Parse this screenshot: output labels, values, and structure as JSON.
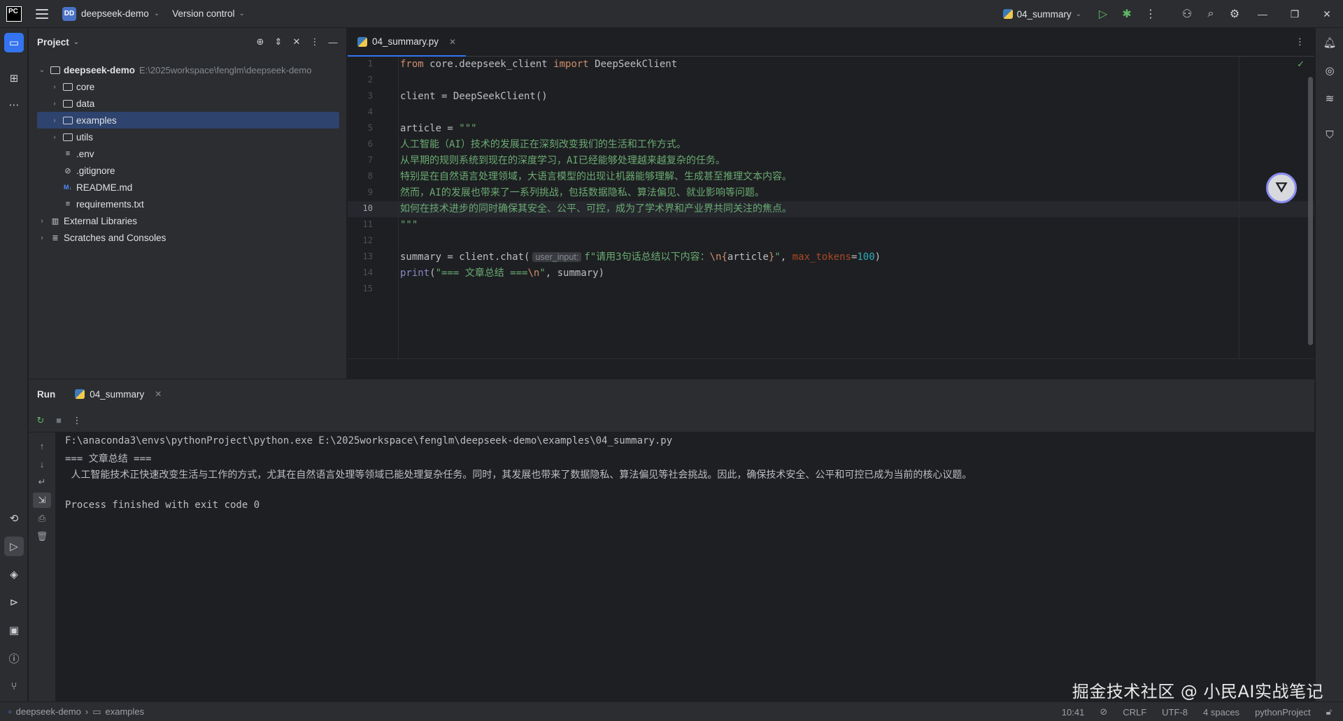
{
  "titlebar": {
    "project_badge": "DD",
    "project_name": "deepseek-demo",
    "vcs": "Version control",
    "run_config": "04_summary"
  },
  "project_panel": {
    "title": "Project",
    "root": {
      "name": "deepseek-demo",
      "path": "E:\\2025workspace\\fenglm\\deepseek-demo"
    },
    "items": [
      {
        "name": "core",
        "type": "folder"
      },
      {
        "name": "data",
        "type": "folder"
      },
      {
        "name": "examples",
        "type": "folder",
        "selected": true
      },
      {
        "name": "utils",
        "type": "folder"
      },
      {
        "name": ".env",
        "type": "file"
      },
      {
        "name": ".gitignore",
        "type": "ignore-file"
      },
      {
        "name": "README.md",
        "type": "markdown"
      },
      {
        "name": "requirements.txt",
        "type": "file"
      }
    ],
    "external_libraries": "External Libraries",
    "scratches": "Scratches and Consoles"
  },
  "editor": {
    "tab": "04_summary.py",
    "current_line": 10,
    "lines": {
      "l1": {
        "kw1": "from",
        "mod": " core.deepseek_client ",
        "kw2": "import",
        "cls": " DeepSeekClient"
      },
      "l3": "client = DeepSeekClient()",
      "l5": {
        "pre": "article = ",
        "str": "\"\"\""
      },
      "l6": "人工智能（AI）技术的发展正在深刻改变我们的生活和工作方式。",
      "l7": "从早期的规则系统到现在的深度学习，AI已经能够处理越来越复杂的任务。",
      "l8": "特别是在自然语言处理领域，大语言模型的出现让机器能够理解、生成甚至推理文本内容。",
      "l9": "然而，AI的发展也带来了一系列挑战，包括数据隐私、算法偏见、就业影响等问题。",
      "l10": "如何在技术进步的同时确保其安全、公平、可控，成为了学术界和产业界共同关注的焦点。",
      "l11": "\"\"\"",
      "l13": {
        "pre": "summary = client.chat(",
        "inlay": "user_input:",
        "str1": "f\"请用3句话总结以下内容：",
        "esc": "\\n",
        "brace_open": "{",
        "var": "article",
        "brace_close": "}",
        "str2": "\"",
        "comma": ", ",
        "param": "max_tokens",
        "eq": "=",
        "num": "100",
        "close": ")"
      },
      "l14": {
        "fn": "print",
        "open": "(",
        "str1": "\"=== 文章总结 ===",
        "esc": "\\n",
        "str2": "\"",
        "rest": ", summary)"
      }
    },
    "line_numbers": [
      "1",
      "2",
      "3",
      "4",
      "5",
      "6",
      "7",
      "8",
      "9",
      "10",
      "11",
      "12",
      "13",
      "14",
      "15"
    ]
  },
  "run_panel": {
    "title": "Run",
    "tab": "04_summary",
    "output": [
      "F:\\anaconda3\\envs\\pythonProject\\python.exe E:\\2025workspace\\fenglm\\deepseek-demo\\examples\\04_summary.py",
      "=== 文章总结 ===",
      " 人工智能技术正快速改变生活与工作的方式，尤其在自然语言处理等领域已能处理复杂任务。同时，其发展也带来了数据隐私、算法偏见等社会挑战。因此，确保技术安全、公平和可控已成为当前的核心议题。",
      "",
      "Process finished with exit code 0"
    ]
  },
  "watermark": "掘金技术社区 @ 小民AI实战笔记",
  "statusbar": {
    "breadcrumb_project": "deepseek-demo",
    "breadcrumb_folder": "examples",
    "position": "10:41",
    "line_sep": "CRLF",
    "encoding": "UTF-8",
    "indent": "4 spaces",
    "interpreter": "pythonProject"
  }
}
